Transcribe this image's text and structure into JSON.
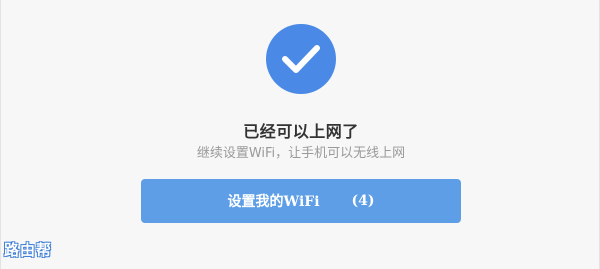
{
  "status": {
    "icon": "checkmark-circle-icon",
    "title": "已经可以上网了",
    "subtitle": "继续设置WiFi，让手机可以无线上网"
  },
  "action_button": {
    "label": "设置我的WiFi",
    "countdown": "(4)"
  },
  "watermark": {
    "text": "路由帮"
  },
  "colors": {
    "accent": "#4a8ae6",
    "button": "#5d9ee6",
    "background": "#f7f7f7"
  }
}
